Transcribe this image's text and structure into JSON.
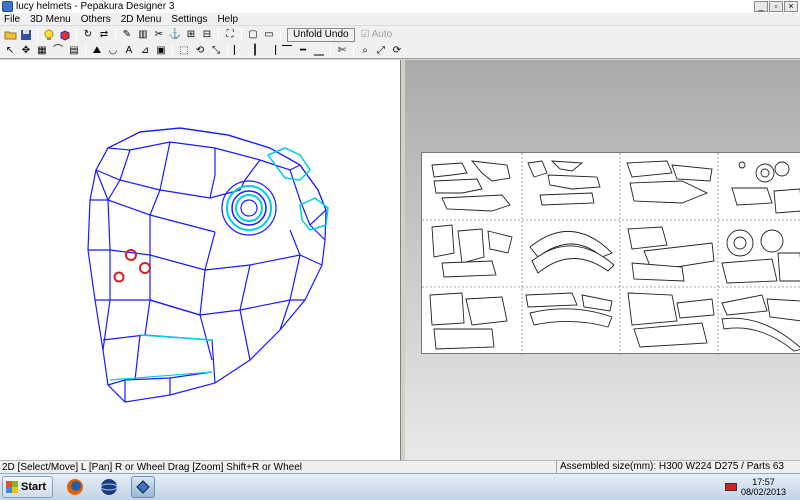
{
  "window": {
    "title": "lucy helmets - Pepakura Designer 3"
  },
  "menubar": {
    "items": [
      "File",
      "3D Menu",
      "Others",
      "2D Menu",
      "Settings",
      "Help"
    ]
  },
  "toolbar": {
    "unfold_undo_label": "Unfold Undo",
    "auto_label": "Auto",
    "row1_icons": [
      "open-folder-icon",
      "save-icon",
      "bulb-icon",
      "cube-icon",
      "rotate-icon",
      "flip-icon",
      "pencil-icon",
      "glue-icon",
      "scissors-icon",
      "anchor-icon",
      "join-icon",
      "fold-icon",
      "select-icon",
      "frame-icon",
      "window-icon"
    ],
    "row2_icons": [
      "pointer-icon",
      "move-icon",
      "grid-icon",
      "edge-icon",
      "face-icon",
      "mountain-icon",
      "valley-icon",
      "text-icon",
      "flap-icon",
      "image-icon",
      "select-part-icon",
      "rotate-part-icon",
      "scale-icon",
      "align-left-icon",
      "align-center-icon",
      "align-right-icon",
      "align-top-icon",
      "align-middle-icon",
      "align-bottom-icon",
      "cut-icon",
      "zoom-icon",
      "fit-icon",
      "reset-icon"
    ]
  },
  "status": {
    "left": "2D [Select/Move] L [Pan] R or Wheel Drag [Zoom] Shift+R or Wheel",
    "right": "Assembled size(mm): H300 W224 D275 / Parts 63"
  },
  "taskbar": {
    "start_label": "Start",
    "time": "17:57",
    "date": "08/02/2013"
  },
  "colors": {
    "mesh_edge": "#1a1aff",
    "cyan_edge": "#00d0e0",
    "red_hole": "#d02020",
    "sheet_bg": "#ffffff"
  }
}
